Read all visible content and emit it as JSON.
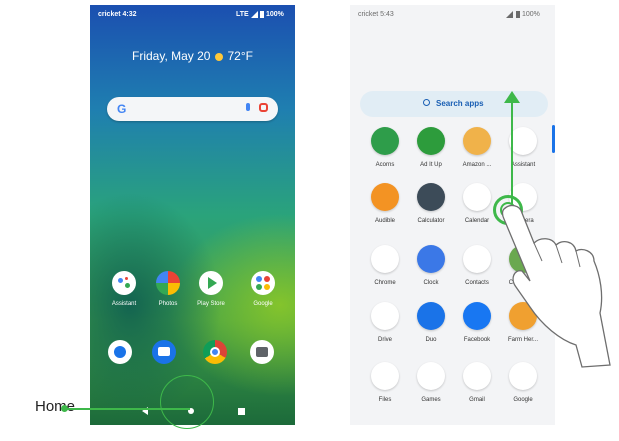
{
  "left_phone": {
    "status": {
      "carrier_time": "cricket 4:32",
      "network": "LTE",
      "battery": "100%"
    },
    "date": "Friday, May 20",
    "weather": "72°F",
    "search": {
      "logo": "G"
    },
    "home_row": [
      {
        "label": "Assistant",
        "icon": "assistant-icon"
      },
      {
        "label": "Photos",
        "icon": "photos-icon"
      },
      {
        "label": "Play Store",
        "icon": "play-store-icon"
      },
      {
        "label": "Google",
        "icon": "google-folder-icon"
      }
    ],
    "dock": [
      {
        "icon": "phone-icon",
        "color": "#1a73e8"
      },
      {
        "icon": "messages-icon",
        "color": "#1a73e8"
      },
      {
        "icon": "chrome-icon",
        "color": "#db4437"
      },
      {
        "icon": "camera-icon",
        "color": "#5f6368"
      }
    ]
  },
  "right_phone": {
    "status": {
      "carrier_time": "cricket 5:43",
      "battery": "100%"
    },
    "search_label": "Search apps",
    "apps": [
      {
        "label": "Acorns",
        "color": "#2e9d4a"
      },
      {
        "label": "Ad It Up",
        "color": "#2d9c3c"
      },
      {
        "label": "Amazon ...",
        "color": "#f0b24a"
      },
      {
        "label": "Assistant",
        "color": "#ffffff"
      },
      {
        "label": "Audible",
        "color": "#f39323"
      },
      {
        "label": "Calculator",
        "color": "#3c4b58"
      },
      {
        "label": "Calendar",
        "color": "#ffffff"
      },
      {
        "label": "Camera",
        "color": "#ffffff"
      },
      {
        "label": "Chrome",
        "color": "#ffffff"
      },
      {
        "label": "Clock",
        "color": "#3b78e7"
      },
      {
        "label": "Contacts",
        "color": "#ffffff"
      },
      {
        "label": "Cricket P...",
        "color": "#6aa84f"
      },
      {
        "label": "Drive",
        "color": "#ffffff"
      },
      {
        "label": "Duo",
        "color": "#1a73e8"
      },
      {
        "label": "Facebook",
        "color": "#1877f2"
      },
      {
        "label": "Farm Her...",
        "color": "#f0a030"
      },
      {
        "label": "Files",
        "color": "#ffffff"
      },
      {
        "label": "Games",
        "color": "#ffffff"
      },
      {
        "label": "Gmail",
        "color": "#ffffff"
      },
      {
        "label": "Google",
        "color": "#ffffff"
      }
    ]
  },
  "annotation": {
    "home_label": "Home",
    "accent": "#3eb84a"
  }
}
